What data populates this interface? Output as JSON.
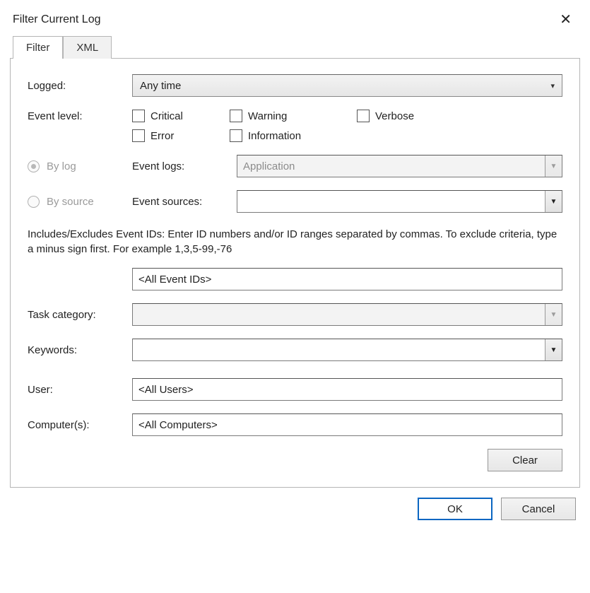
{
  "title": "Filter Current Log",
  "tabs": {
    "filter": "Filter",
    "xml": "XML"
  },
  "labels": {
    "logged": "Logged:",
    "event_level": "Event level:",
    "by_log": "By log",
    "by_source": "By source",
    "event_logs": "Event logs:",
    "event_sources": "Event sources:",
    "task_category": "Task category:",
    "keywords": "Keywords:",
    "user": "User:",
    "computers": "Computer(s):"
  },
  "values": {
    "logged": "Any time",
    "event_logs": "Application",
    "event_sources": "",
    "event_ids": "<All Event IDs>",
    "task_category": "",
    "keywords": "",
    "user": "<All Users>",
    "computers": "<All Computers>"
  },
  "levels": {
    "critical": "Critical",
    "warning": "Warning",
    "verbose": "Verbose",
    "error": "Error",
    "information": "Information"
  },
  "help": "Includes/Excludes Event IDs: Enter ID numbers and/or ID ranges separated by commas. To exclude criteria, type a minus sign first. For example 1,3,5-99,-76",
  "buttons": {
    "clear": "Clear",
    "ok": "OK",
    "cancel": "Cancel"
  }
}
